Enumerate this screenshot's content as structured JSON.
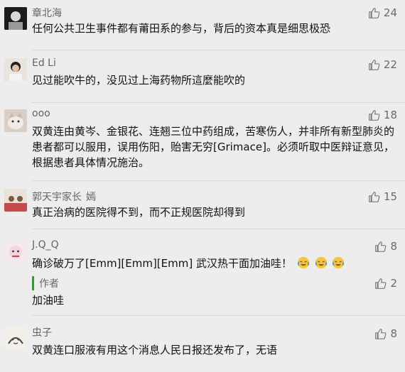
{
  "comments": [
    {
      "name": "章北海",
      "text": "任何公共卫生事件都有莆田系的参与，背后的资本真是细思极恐",
      "likes": "24"
    },
    {
      "name": "Ed Li",
      "text": "见过能吹牛的，没见过上海药物所這麼能吹的",
      "likes": "22"
    },
    {
      "name": "ooo",
      "text": "双黄连由黄岑、金银花、连翘三位中药组成，苦寒伤人，并非所有新型肺炎的患者都可以服用，误用伤阳，贻害无穷[Grimace]。必须听取中医辩证意见，根据患者具体情况施治。",
      "likes": "18"
    },
    {
      "name": "郭天宇家长",
      "tag": "嫣",
      "text": "真正治病的医院得不到，而不正规医院却得到",
      "likes": "15"
    },
    {
      "name": "J.Q_Q",
      "text": "确诊破万了[Emm][Emm][Emm]  武汉热干面加油哇！",
      "likes": "8",
      "reply": {
        "author_label": "作者",
        "text": "加油哇",
        "likes": "2"
      }
    },
    {
      "name": "虫子",
      "text": "双黄连口服液有用这个消息人民日报还发布了，无语",
      "likes": "8"
    }
  ],
  "colors": {
    "background": "#ededed",
    "author_bar": "#1aad19",
    "meta_text": "#646464"
  },
  "icons": {
    "like": "thumbs-up-icon",
    "emoji": "cry-laugh-emoji-icon"
  }
}
